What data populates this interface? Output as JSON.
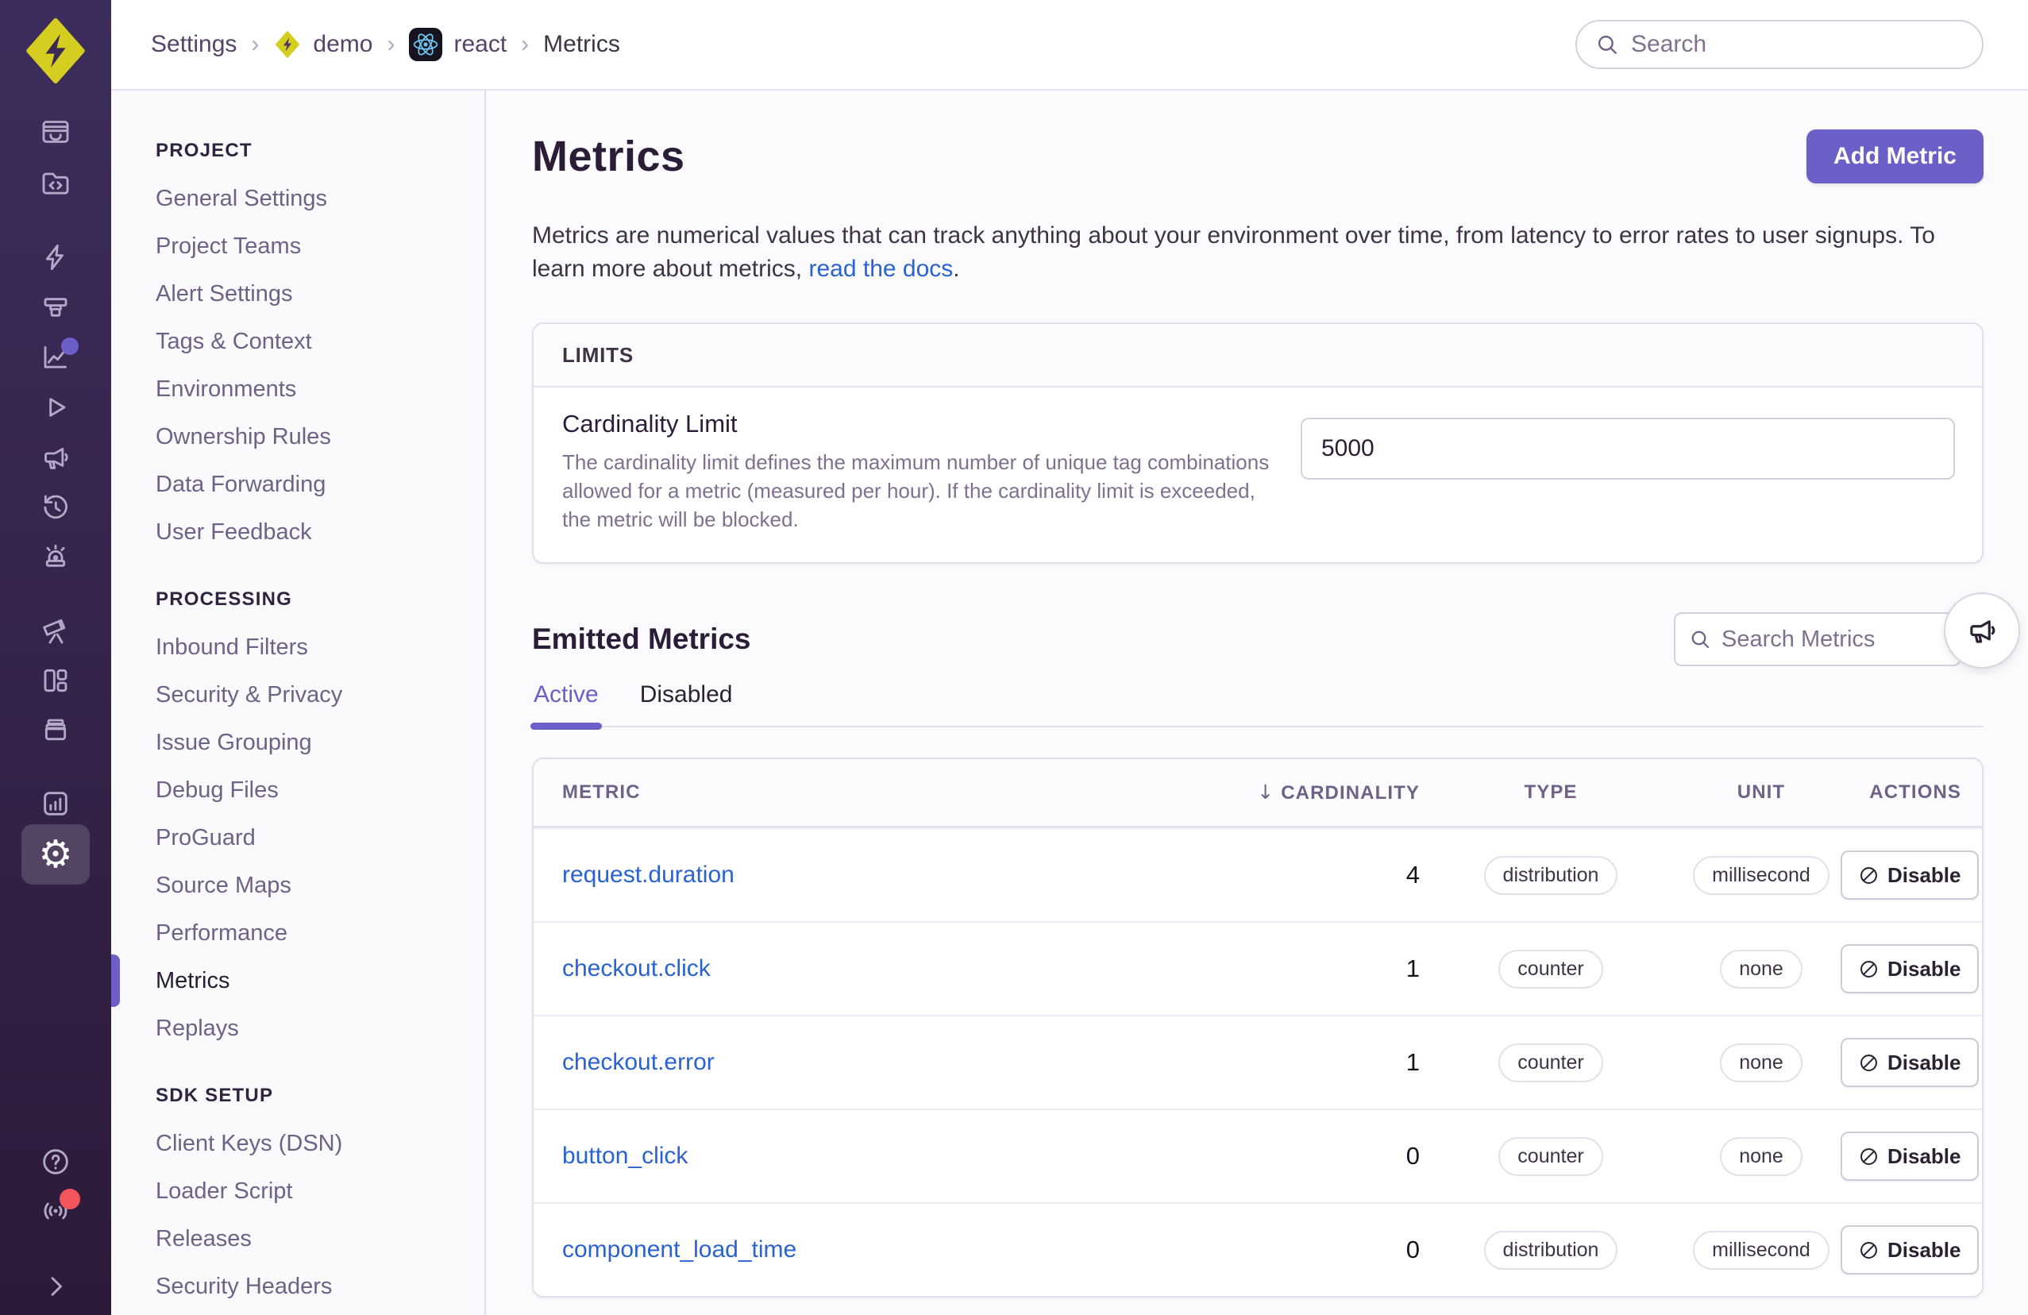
{
  "colors": {
    "accent_purple": "#6C5FC7",
    "link_blue": "#2962D2",
    "sidebar_top": "#3D2D5C",
    "sidebar_bottom": "#2D1A39",
    "logo_lime": "#D5CE21",
    "badge_red": "#F4555C",
    "react_blue": "#6FC7EF"
  },
  "topbar": {
    "breadcrumb": {
      "settings": "Settings",
      "org": "demo",
      "project": "react",
      "page": "Metrics",
      "separator": "›"
    },
    "search_placeholder": "Search"
  },
  "sidebar": {
    "icons": [
      "inbox-issues",
      "code-folder-explore",
      "lightning",
      "projector-insights",
      "chart-line-metrics",
      "play-replays",
      "megaphone-feedback",
      "history-clock",
      "siren-alerts",
      "telescope-discover",
      "dashboard-grid",
      "archive-releases",
      "stats-chart",
      "settings-gear",
      "help-circle",
      "broadcast",
      "chevron-right-collapse"
    ]
  },
  "nav": {
    "sections": [
      {
        "title": "PROJECT",
        "items": [
          "General Settings",
          "Project Teams",
          "Alert Settings",
          "Tags & Context",
          "Environments",
          "Ownership Rules",
          "Data Forwarding",
          "User Feedback"
        ]
      },
      {
        "title": "PROCESSING",
        "items": [
          "Inbound Filters",
          "Security & Privacy",
          "Issue Grouping",
          "Debug Files",
          "ProGuard",
          "Source Maps",
          "Performance",
          "Metrics",
          "Replays"
        ]
      },
      {
        "title": "SDK SETUP",
        "items": [
          "Client Keys (DSN)",
          "Loader Script",
          "Releases",
          "Security Headers"
        ]
      }
    ],
    "active_item": "Metrics"
  },
  "main": {
    "title": "Metrics",
    "add_button": "Add Metric",
    "desc_before": "Metrics are numerical values that can track anything about your environment over time, from latency to error rates to user signups. To learn more about metrics, ",
    "desc_link": "read the docs",
    "desc_after": ".",
    "limits": {
      "header": "LIMITS",
      "label": "Cardinality Limit",
      "description": "The cardinality limit defines the maximum number of unique tag combinations allowed for a metric (measured per hour). If the cardinality limit is exceeded, the metric will be blocked.",
      "value": "5000"
    },
    "emitted": {
      "title": "Emitted Metrics",
      "search_placeholder": "Search Metrics",
      "tabs": [
        {
          "label": "Active",
          "active": true
        },
        {
          "label": "Disabled",
          "active": false
        }
      ],
      "table": {
        "sort_indicator": "↓",
        "headers": {
          "metric": "Metric",
          "cardinality": "Cardinality",
          "type": "Type",
          "unit": "Unit",
          "actions": "Actions"
        },
        "disable_label": "Disable",
        "rows": [
          {
            "metric": "request.duration",
            "cardinality": "4",
            "type": "distribution",
            "unit": "millisecond"
          },
          {
            "metric": "checkout.click",
            "cardinality": "1",
            "type": "counter",
            "unit": "none"
          },
          {
            "metric": "checkout.error",
            "cardinality": "1",
            "type": "counter",
            "unit": "none"
          },
          {
            "metric": "button_click",
            "cardinality": "0",
            "type": "counter",
            "unit": "none"
          },
          {
            "metric": "component_load_time",
            "cardinality": "0",
            "type": "distribution",
            "unit": "millisecond"
          }
        ]
      }
    }
  }
}
